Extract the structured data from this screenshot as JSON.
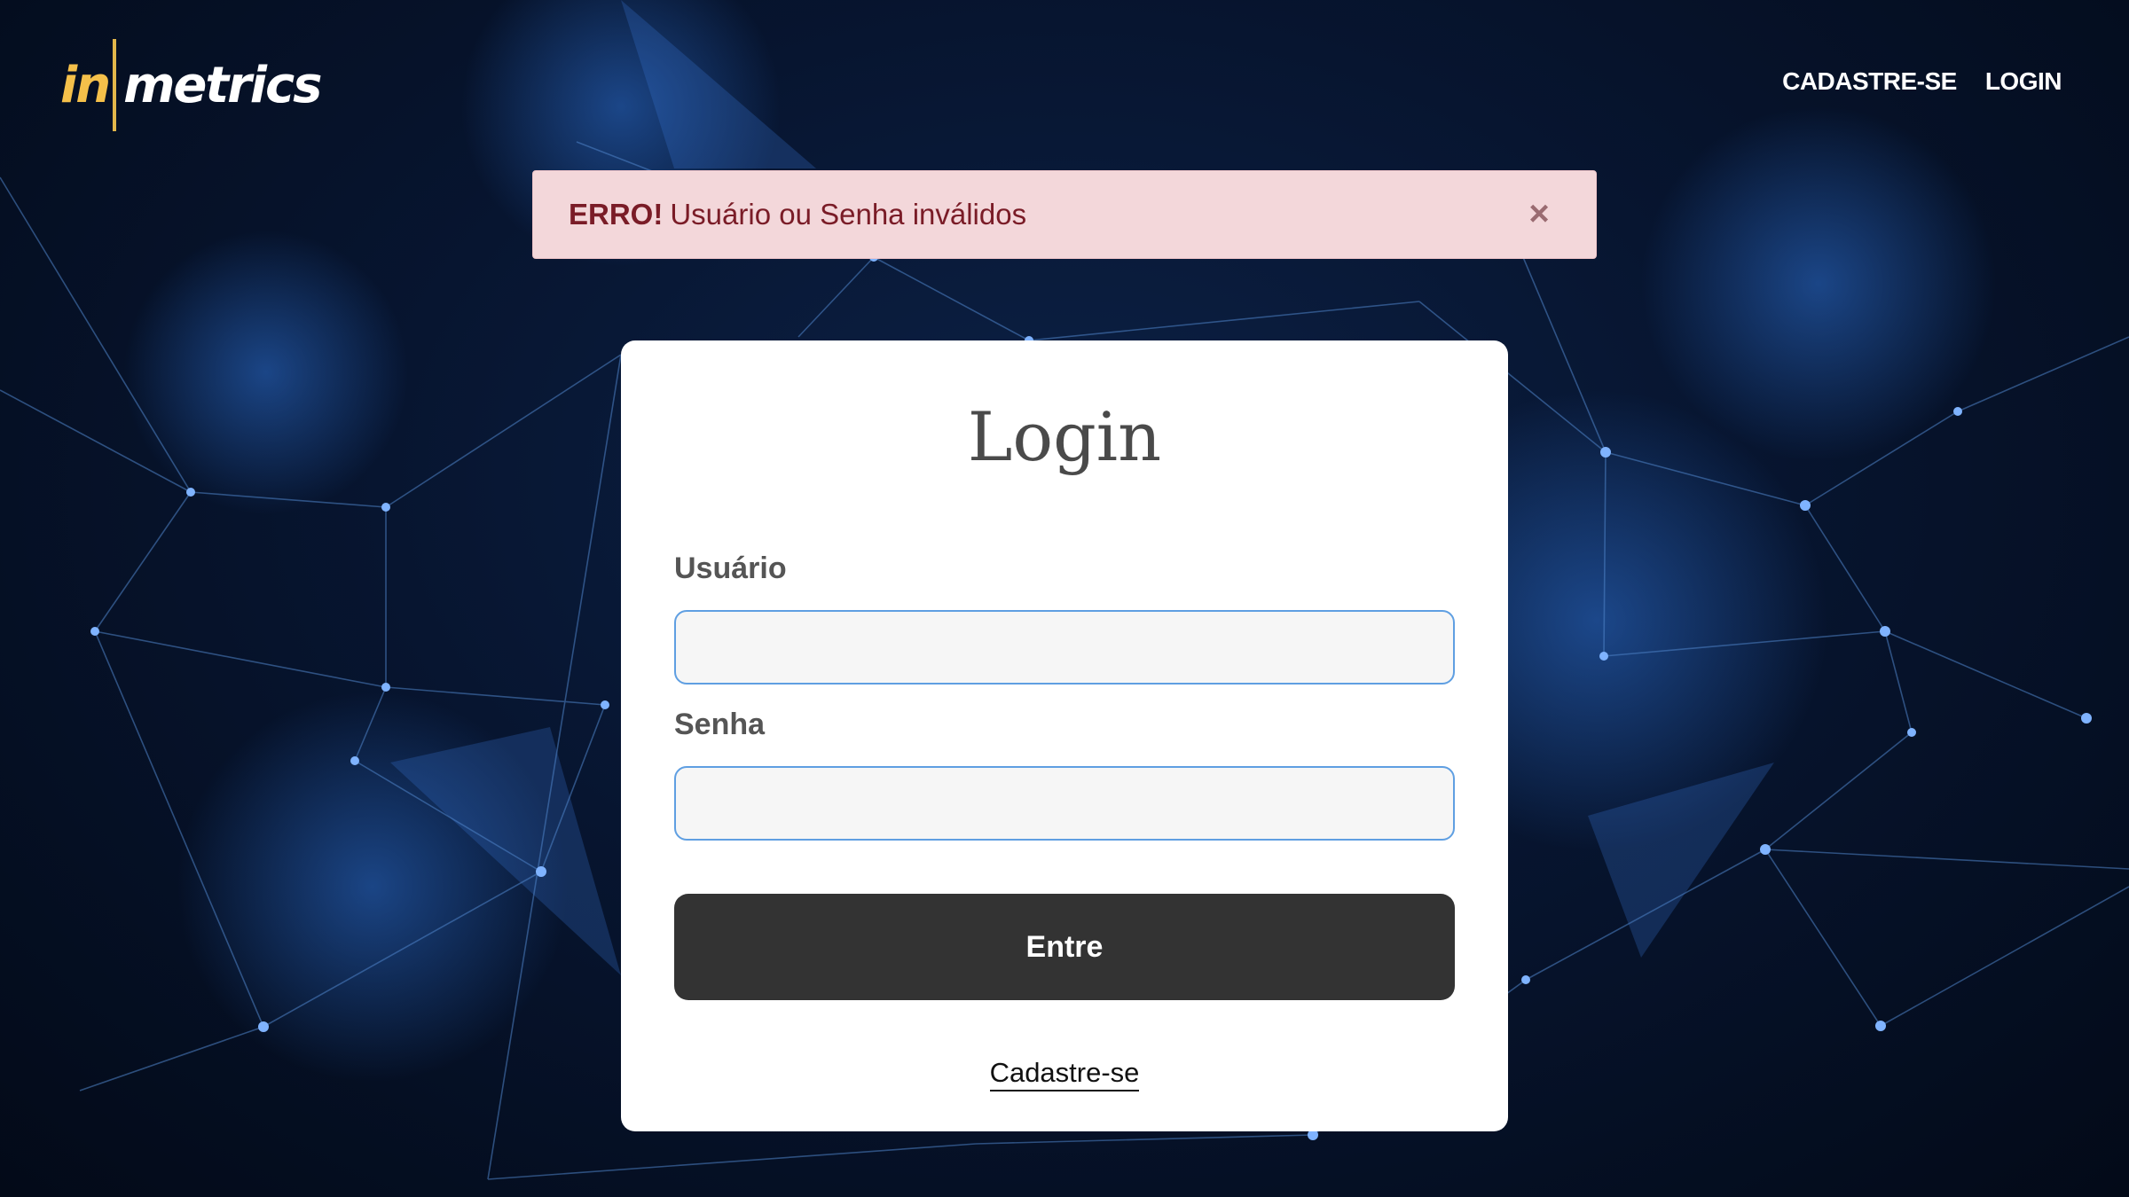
{
  "header": {
    "logo": {
      "part1": "in",
      "part2": "metrics"
    },
    "nav": {
      "register": "CADASTRE-SE",
      "login": "LOGIN"
    }
  },
  "alert": {
    "title": "ERRO!",
    "message": "Usuário ou Senha inválidos",
    "close_symbol": "×"
  },
  "login": {
    "title": "Login",
    "username_label": "Usuário",
    "username_value": "",
    "password_label": "Senha",
    "password_value": "",
    "submit_label": "Entre",
    "register_link": "Cadastre-se"
  },
  "colors": {
    "alert_bg": "#f3d7da",
    "alert_text": "#7a1c27",
    "button_bg": "#333333",
    "input_border": "#5f9fe2",
    "logo_accent": "#f5c04a"
  }
}
